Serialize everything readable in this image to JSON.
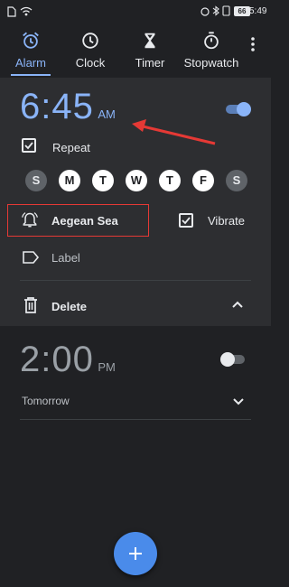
{
  "status_bar": {
    "time": "5:49",
    "battery": "66"
  },
  "tabs": [
    {
      "label": "Alarm",
      "icon": "alarm-icon",
      "active": true
    },
    {
      "label": "Clock",
      "icon": "clock-icon",
      "active": false
    },
    {
      "label": "Timer",
      "icon": "hourglass-icon",
      "active": false
    },
    {
      "label": "Stopwatch",
      "icon": "stopwatch-icon",
      "active": false
    }
  ],
  "alarms": [
    {
      "time": "6:45",
      "ampm": "AM",
      "enabled": true,
      "repeat_label": "Repeat",
      "repeat_checked": true,
      "days": [
        {
          "letter": "S",
          "selected": false
        },
        {
          "letter": "M",
          "selected": true
        },
        {
          "letter": "T",
          "selected": true
        },
        {
          "letter": "W",
          "selected": true
        },
        {
          "letter": "T",
          "selected": true
        },
        {
          "letter": "F",
          "selected": true
        },
        {
          "letter": "S",
          "selected": false
        }
      ],
      "ringtone": "Aegean Sea",
      "vibrate_label": "Vibrate",
      "vibrate_checked": true,
      "label_placeholder": "Label",
      "delete_label": "Delete"
    },
    {
      "time": "2:00",
      "ampm": "PM",
      "enabled": false,
      "subtitle": "Tomorrow"
    }
  ],
  "colors": {
    "accent": "#8ab4f8",
    "annotation_red": "#e53935"
  }
}
